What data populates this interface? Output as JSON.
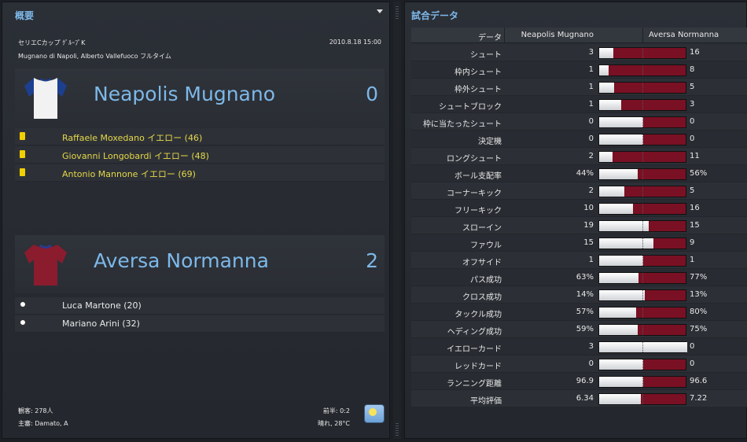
{
  "overview": {
    "title": "概要",
    "competition": "セリエCカップ ｸﾞﾙｰﾌﾟK",
    "datetime": "2010.8.18 15:00",
    "venue": "Mugnano di Napoli, Alberto Vallefuoco フルタイム",
    "home": {
      "name": "Neapolis Mugnano",
      "score": "0",
      "shirt_color": "#f2f2f2",
      "sleeve_color": "#1d3f8f",
      "events": [
        {
          "icon": "yellow-card-icon",
          "text": "Raffaele Moxedano イエロー (46)"
        },
        {
          "icon": "yellow-card-icon",
          "text": "Giovanni Longobardi イエロー (48)"
        },
        {
          "icon": "yellow-card-icon",
          "text": "Antonio Mannone イエロー (69)"
        }
      ]
    },
    "away": {
      "name": "Aversa Normanna",
      "score": "2",
      "shirt_color": "#8a1c2e",
      "sleeve_color": "#2a3a8a",
      "events": [
        {
          "icon": "ball-icon",
          "text": "Luca Martone (20)"
        },
        {
          "icon": "ball-icon",
          "text": "Mariano Arini (32)"
        }
      ]
    },
    "attendance": "観客: 278人",
    "referee": "主審: Damato, A",
    "halftime": "前半: 0:2",
    "weather": "晴れ, 28°C"
  },
  "stats": {
    "title": "試合データ",
    "header": {
      "label": "データ",
      "home": "Neapolis Mugnano",
      "away": "Aversa Normanna"
    },
    "rows": [
      {
        "label": "シュート",
        "home": "3",
        "away": "16",
        "home_share": 0.16
      },
      {
        "label": "枠内シュート",
        "home": "1",
        "away": "8",
        "home_share": 0.11
      },
      {
        "label": "枠外シュート",
        "home": "1",
        "away": "5",
        "home_share": 0.17
      },
      {
        "label": "シュートブロック",
        "home": "1",
        "away": "3",
        "home_share": 0.25
      },
      {
        "label": "枠に当たったシュート",
        "home": "0",
        "away": "0",
        "home_share": 0.5
      },
      {
        "label": "決定機",
        "home": "0",
        "away": "0",
        "home_share": 0.5
      },
      {
        "label": "ロングシュート",
        "home": "2",
        "away": "11",
        "home_share": 0.15
      },
      {
        "label": "ボール支配率",
        "home": "44%",
        "away": "56%",
        "home_share": 0.44
      },
      {
        "label": "コーナーキック",
        "home": "2",
        "away": "5",
        "home_share": 0.29
      },
      {
        "label": "フリーキック",
        "home": "10",
        "away": "16",
        "home_share": 0.38
      },
      {
        "label": "スローイン",
        "home": "19",
        "away": "15",
        "home_share": 0.56
      },
      {
        "label": "ファウル",
        "home": "15",
        "away": "9",
        "home_share": 0.62
      },
      {
        "label": "オフサイド",
        "home": "1",
        "away": "1",
        "home_share": 0.5
      },
      {
        "label": "パス成功",
        "home": "63%",
        "away": "77%",
        "home_share": 0.45
      },
      {
        "label": "クロス成功",
        "home": "14%",
        "away": "13%",
        "home_share": 0.52
      },
      {
        "label": "タックル成功",
        "home": "57%",
        "away": "80%",
        "home_share": 0.42
      },
      {
        "label": "ヘディング成功",
        "home": "59%",
        "away": "75%",
        "home_share": 0.44
      },
      {
        "label": "イエローカード",
        "home": "3",
        "away": "0",
        "home_share": 1.0
      },
      {
        "label": "レッドカード",
        "home": "0",
        "away": "0",
        "home_share": 0.5
      },
      {
        "label": "ランニング距離",
        "home": "96.9",
        "away": "96.6",
        "home_share": 0.5
      },
      {
        "label": "平均評価",
        "home": "6.34",
        "away": "7.22",
        "home_share": 0.47
      }
    ]
  }
}
